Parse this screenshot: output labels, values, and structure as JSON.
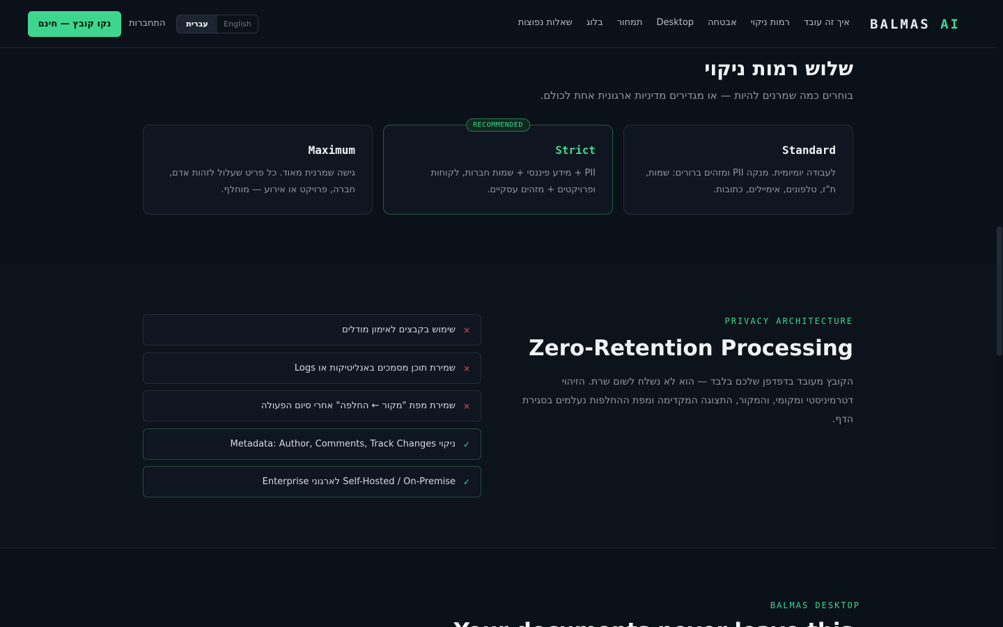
{
  "header": {
    "logo_main": "BALMAS",
    "logo_accent": "AI",
    "nav": [
      "איך זה עובד",
      "רמות ניקוי",
      "אבטחה",
      "Desktop",
      "תמחור",
      "בלוג",
      "שאלות נפוצות"
    ],
    "lang_active": "עברית",
    "lang_inactive": "English",
    "login": "התחברות",
    "cta": "נקו קובץ — חינם"
  },
  "levels": {
    "title": "שלוש רמות ניקוי",
    "subtitle": "בוחרים כמה שמרנים להיות — או מגדירים מדיניות ארגונית אחת לכולם.",
    "badge": "RECOMMENDED",
    "cards": [
      {
        "title": "Standard",
        "desc": "לעבודה יומיומית. מנקה PII ומזהים ברורים: שמות, ת\"ז, טלפונים, אימיילים, כתובות."
      },
      {
        "title": "Strict",
        "desc": "PII + מידע פיננסי + שמות חברות, לקוחות ופרויקטים + מזהים עסקיים."
      },
      {
        "title": "Maximum",
        "desc": "גישה שמרנית מאוד. כל פריט שעלול לזהות אדם, חברה, פרויקט או אירוע — מוחלף."
      }
    ]
  },
  "privacy": {
    "eyebrow": "PRIVACY ARCHITECTURE",
    "title": "Zero-Retention Processing",
    "desc": "הקובץ מעובד בדפדפן שלכם בלבד — הוא לא נשלח לשום שרת. הזיהוי דטרמיניסטי ומקומי, והמקור, התצוגה המקדימה ומפת ההחלפות נעלמים בסגירת הדף.",
    "items": [
      {
        "text": "שימוש בקבצים לאימון מודלים",
        "mark": "×"
      },
      {
        "text": "שמירת תוכן מסמכים באנליטיקות או Logs",
        "mark": "×"
      },
      {
        "text": "שמירת מפת \"מקור ← החלפה\" אחרי סיום הפעולה",
        "mark": "×"
      },
      {
        "text": "ניקוי Metadata: Author, Comments, Track Changes",
        "mark": "✓"
      },
      {
        "text": "Self-Hosted / On-Premise לארגוני Enterprise",
        "mark": "✓"
      }
    ]
  },
  "desktop": {
    "eyebrow": "BALMAS DESKTOP",
    "title": "Your documents never leave this"
  },
  "colors": {
    "accent": "#3fd690",
    "background": "#0b1119",
    "danger": "#e2505e"
  }
}
